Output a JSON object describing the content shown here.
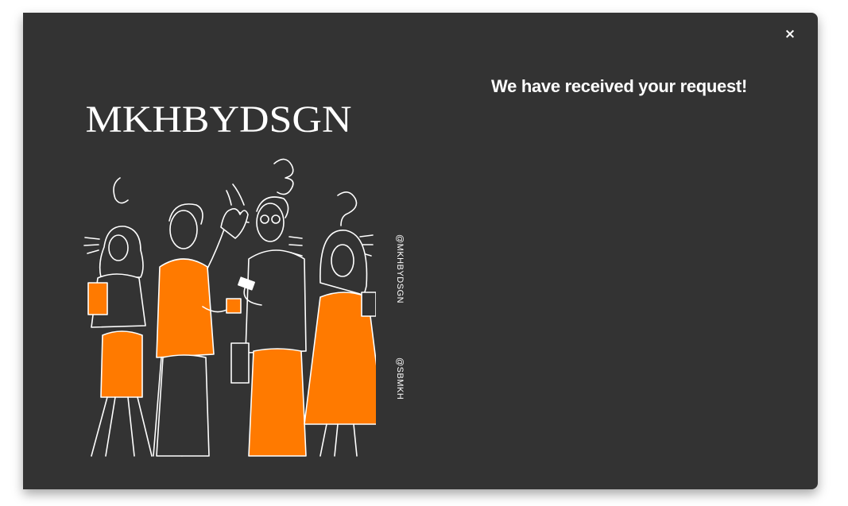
{
  "modal": {
    "close_label": "×",
    "headline": "We have received your request!"
  },
  "artwork": {
    "logo_text": "MKHBYDSGN",
    "icon": "team-illustration-icon",
    "accent_color": "#ff7a00",
    "line_color": "#ffffff",
    "background_color": "#333333"
  },
  "social": {
    "handle_1": "@MKHBYDSGN",
    "handle_2": "@SBMKH"
  }
}
